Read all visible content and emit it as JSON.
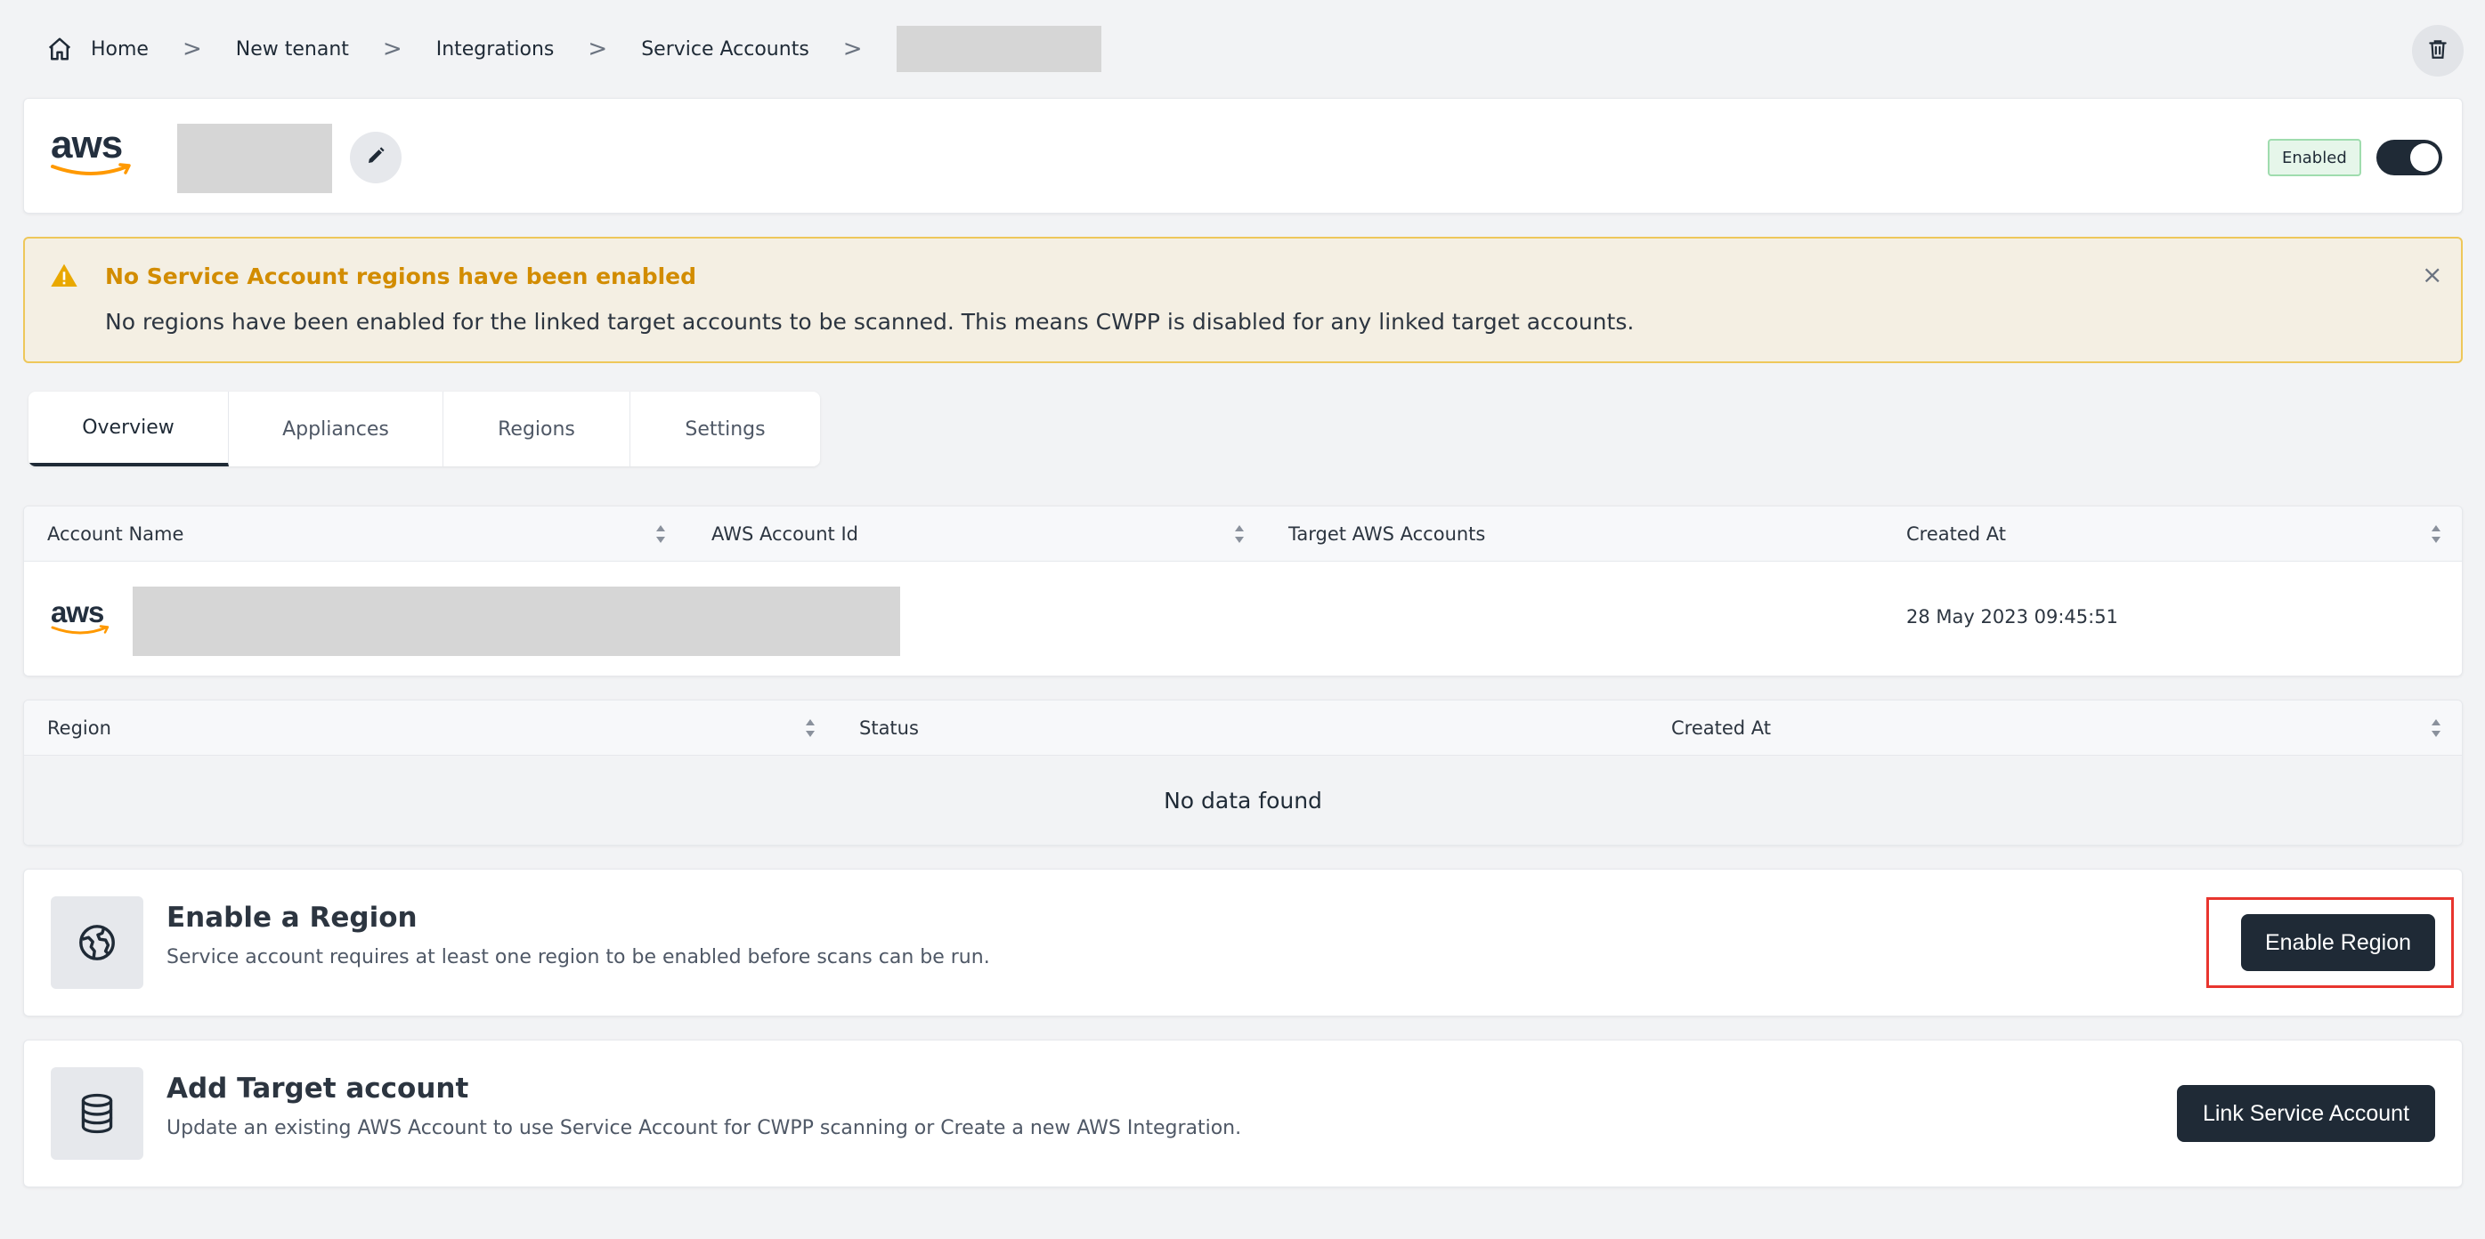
{
  "breadcrumb": {
    "items": [
      "Home",
      "New tenant",
      "Integrations",
      "Service Accounts"
    ],
    "separator": ">"
  },
  "header": {
    "logo_text": "aws",
    "status_badge": "Enabled",
    "toggle_on": true
  },
  "alert": {
    "title": "No Service Account regions have been enabled",
    "body": "No regions have been enabled for the linked target accounts to be scanned. This means CWPP is disabled for any linked target accounts.",
    "close": "×"
  },
  "tabs": [
    {
      "label": "Overview",
      "active": true
    },
    {
      "label": "Appliances",
      "active": false
    },
    {
      "label": "Regions",
      "active": false
    },
    {
      "label": "Settings",
      "active": false
    }
  ],
  "accounts_table": {
    "headers": [
      "Account Name",
      "AWS Account Id",
      "Target AWS Accounts",
      "Created At"
    ],
    "rows": [
      {
        "logo": "aws",
        "created_at": "28 May 2023 09:45:51"
      }
    ]
  },
  "regions_table": {
    "headers": [
      "Region",
      "Status",
      "Created At"
    ],
    "empty_text": "No data found"
  },
  "enable_region": {
    "title": "Enable a Region",
    "description": "Service account requires at least one region to be enabled before scans can be run.",
    "button": "Enable Region",
    "icon": "globe-icon"
  },
  "add_target": {
    "title": "Add Target account",
    "description": "Update an existing AWS Account to use Service Account for CWPP scanning or Create a new AWS Integration.",
    "button": "Link Service Account",
    "icon": "database-icon"
  },
  "colors": {
    "dark": "#1f2a36",
    "alert_title": "#d28c00",
    "alert_border": "#eec75a",
    "aws_orange": "#ff9900",
    "highlight": "#e8352e"
  }
}
